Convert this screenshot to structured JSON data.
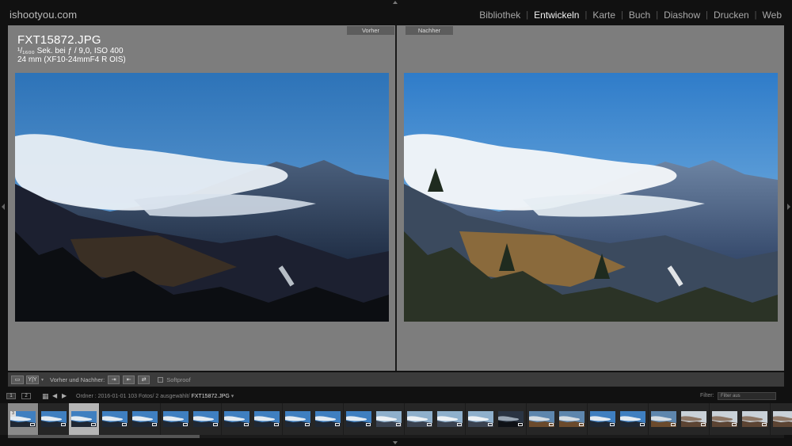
{
  "app": {
    "identity": "ishootyou.com",
    "modules": [
      {
        "label": "Bibliothek",
        "active": false
      },
      {
        "label": "Entwickeln",
        "active": true
      },
      {
        "label": "Karte",
        "active": false
      },
      {
        "label": "Buch",
        "active": false
      },
      {
        "label": "Diashow",
        "active": false
      },
      {
        "label": "Drucken",
        "active": false
      },
      {
        "label": "Web",
        "active": false
      }
    ],
    "module_separator": "|"
  },
  "compare": {
    "before_label": "Vorher",
    "after_label": "Nachher",
    "info": {
      "filename": "FXT15872.JPG",
      "exposure": "¹/₁₆₀₀ Sek. bei ƒ / 9,0, ISO 400",
      "lens": "24 mm (XF10-24mmF4 R OIS)"
    }
  },
  "toolbar": {
    "view_icon": "loupe-view-icon",
    "yy_label": "Y|Y",
    "yy_caret": "▾",
    "before_after_label": "Vorher und Nachher:",
    "softproof_label": "Softproof",
    "softproof_checked": false
  },
  "filmstrip_bar": {
    "screen1": "1",
    "screen2": "2",
    "grid_icon": "▦",
    "prev_icon": "◀",
    "next_icon": "▶",
    "path_prefix": "Ordner : 2016-01-01",
    "path_counts": "103 Fotos/ 2 ausgewählt/",
    "path_current": "FXT15872.JPG",
    "path_caret": "▾",
    "filter_label": "Filter:",
    "filter_value": "Filter aus"
  },
  "filmstrip": {
    "selected_number": "3",
    "thumbs": [
      {
        "tone": "blue",
        "state": "selected"
      },
      {
        "tone": "blue",
        "state": "normal"
      },
      {
        "tone": "blue",
        "state": "primary"
      },
      {
        "tone": "blue",
        "state": "normal"
      },
      {
        "tone": "blue",
        "state": "normal"
      },
      {
        "tone": "blue",
        "state": "normal"
      },
      {
        "tone": "blue",
        "state": "normal"
      },
      {
        "tone": "blue",
        "state": "normal"
      },
      {
        "tone": "blue",
        "state": "normal"
      },
      {
        "tone": "blue",
        "state": "normal"
      },
      {
        "tone": "blue",
        "state": "normal"
      },
      {
        "tone": "blue",
        "state": "normal"
      },
      {
        "tone": "pale",
        "state": "normal"
      },
      {
        "tone": "pale",
        "state": "normal"
      },
      {
        "tone": "pale",
        "state": "normal"
      },
      {
        "tone": "pale",
        "state": "normal"
      },
      {
        "tone": "dark",
        "state": "normal"
      },
      {
        "tone": "warm",
        "state": "normal"
      },
      {
        "tone": "warm",
        "state": "normal"
      },
      {
        "tone": "blue",
        "state": "normal"
      },
      {
        "tone": "blue",
        "state": "normal"
      },
      {
        "tone": "warm",
        "state": "normal"
      },
      {
        "tone": "people",
        "state": "normal"
      },
      {
        "tone": "people",
        "state": "normal"
      },
      {
        "tone": "people",
        "state": "normal"
      },
      {
        "tone": "people",
        "state": "normal"
      }
    ]
  },
  "colors": {
    "panel_bg": "#7d7d7d",
    "app_bg": "#111111",
    "active_module": "#f2f2f2",
    "inactive_module": "#a8a8a8"
  }
}
